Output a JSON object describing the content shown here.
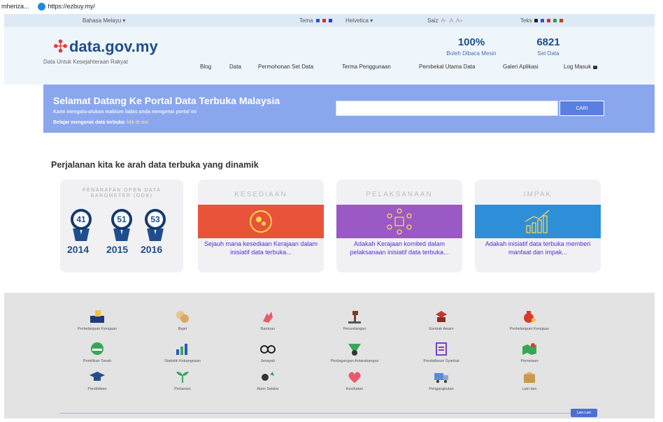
{
  "browser": {
    "bookmark_left": "mheriza...",
    "bookmark_link": "https://ezbuy.my/"
  },
  "accessibility": {
    "language": "Bahasa Melayu",
    "theme_label": "Tema",
    "font_label": "Helvetica",
    "size_label": "Saiz",
    "size_a1": "A-",
    "size_a2": "A",
    "size_a3": "A+",
    "text_label": "Teks",
    "theme_colors": [
      "#2a56c6",
      "#d32f2f",
      "#3b2fd3"
    ],
    "text_colors": [
      "#222222",
      "#2a56c6",
      "#d32f2f",
      "#2e9d47",
      "#d32f2f"
    ]
  },
  "header": {
    "logo_text": "data.gov.my",
    "tagline": "Data Untuk Kesejahteraan Rakyat",
    "stat1_value": "100%",
    "stat1_label": "Boleh Dibaca Mesin",
    "stat2_value": "6821",
    "stat2_label": "Set Data",
    "nav": [
      "Blog",
      "Data",
      "Permohonan Set Data",
      "Terma Penggunaan",
      "Pembekal Utama Data",
      "Galeri Aplikasi",
      "Log Masuk"
    ]
  },
  "hero": {
    "title": "Selamat Datang Ke Portal Data Terbuka Malaysia",
    "subtitle": "Kami mengalu-alukan maklum balas anda mengenai portal ini",
    "learn_prefix": "Belajar mengenai data terbuka:",
    "learn_link": "klik di sini",
    "search_placeholder": "",
    "search_button": "CARI"
  },
  "journey": {
    "title": "Perjalanan kita ke arah data terbuka yang dinamik",
    "odb_title": "PENARAFAN OPEN DATA BAROMETER (ODB)",
    "medals": [
      {
        "score": "41",
        "year": "2014"
      },
      {
        "score": "51",
        "year": "2015"
      },
      {
        "score": "53",
        "year": "2016"
      }
    ],
    "cards": [
      {
        "title": "KESEDIAAN",
        "desc": "Sejauh mana kesediaan Kerajaan dalam inisiatif data terbuka...",
        "color": "#e8533a"
      },
      {
        "title": "PELAKSANAAN",
        "desc": "Adakah Kerajaan komited dalam pelaksanaan inisiatif data terbuka...",
        "color": "#9b59c6"
      },
      {
        "title": "IMPAK",
        "desc": "Adakah inisiatif data terbuka memberi manfaat dan impak...",
        "color": "#2e8fd8"
      }
    ]
  },
  "categories": {
    "items": [
      {
        "label": "Perbelanjaan Kerajaan",
        "icon": "ballot-box-icon"
      },
      {
        "label": "Bajet",
        "icon": "coins-icon"
      },
      {
        "label": "Bantuan",
        "icon": "helping-hand-icon"
      },
      {
        "label": "Perundangan",
        "icon": "gavel-icon"
      },
      {
        "label": "Kontrak Awam",
        "icon": "contract-icon"
      },
      {
        "label": "Perbelanjaan Kerajaan",
        "icon": "money-bag-icon"
      },
      {
        "label": "Pemilikan Tanah",
        "icon": "land-icon"
      },
      {
        "label": "Statistik Kebangsaan",
        "icon": "statistics-icon"
      },
      {
        "label": "Jenayah",
        "icon": "handcuffs-icon"
      },
      {
        "label": "Perdagangan Antarabangsa",
        "icon": "globe-money-icon"
      },
      {
        "label": "Pendaftaran Syarikat",
        "icon": "registration-icon"
      },
      {
        "label": "Pemetaan",
        "icon": "map-icon"
      },
      {
        "label": "Pendidikan",
        "icon": "graduation-cap-icon"
      },
      {
        "label": "Pertanian",
        "icon": "sprout-icon"
      },
      {
        "label": "Alam Sekitar",
        "icon": "environment-icon"
      },
      {
        "label": "Kesihatan",
        "icon": "heart-icon"
      },
      {
        "label": "Pengangkutan",
        "icon": "truck-icon"
      },
      {
        "label": "Lain-lain",
        "icon": "box-icon"
      }
    ],
    "more_button": "Lain-Lain"
  }
}
